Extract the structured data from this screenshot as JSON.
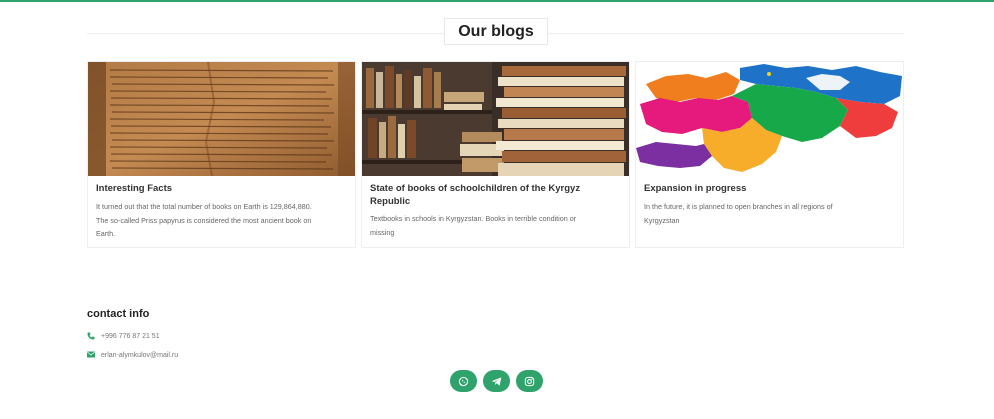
{
  "section": {
    "title": "Our blogs"
  },
  "cards": [
    {
      "image": "papyrus-manuscript",
      "title": "Interesting Facts",
      "text_lines": [
        "It turned out that the total number of books on Earth is 129,864,880.",
        "The so-called Priss papyrus is considered the most ancient book on",
        "Earth."
      ]
    },
    {
      "image": "stack-of-books",
      "title_lines": [
        "State of books of schoolchildren of the Kyrgyz",
        "Republic"
      ],
      "text_lines": [
        "Textbooks in schools in Kyrgyzstan. Books in terrible condition or",
        "missing"
      ]
    },
    {
      "image": "kyrgyzstan-regions-map",
      "title": "Expansion in progress",
      "text_lines": [
        "In the future, it is planned to open branches in all regions of",
        "Kyrgyzstan"
      ]
    }
  ],
  "contact": {
    "heading": "contact info",
    "phone": "+996 776 87 21 51",
    "email": "erlan-alymkulov@mail.ru"
  },
  "socials": [
    {
      "icon": "whatsapp-icon"
    },
    {
      "icon": "telegram-icon"
    },
    {
      "icon": "instagram-icon"
    }
  ],
  "colors": {
    "accent": "#2fa36b",
    "heading": "#222222",
    "body_text": "#666666"
  }
}
